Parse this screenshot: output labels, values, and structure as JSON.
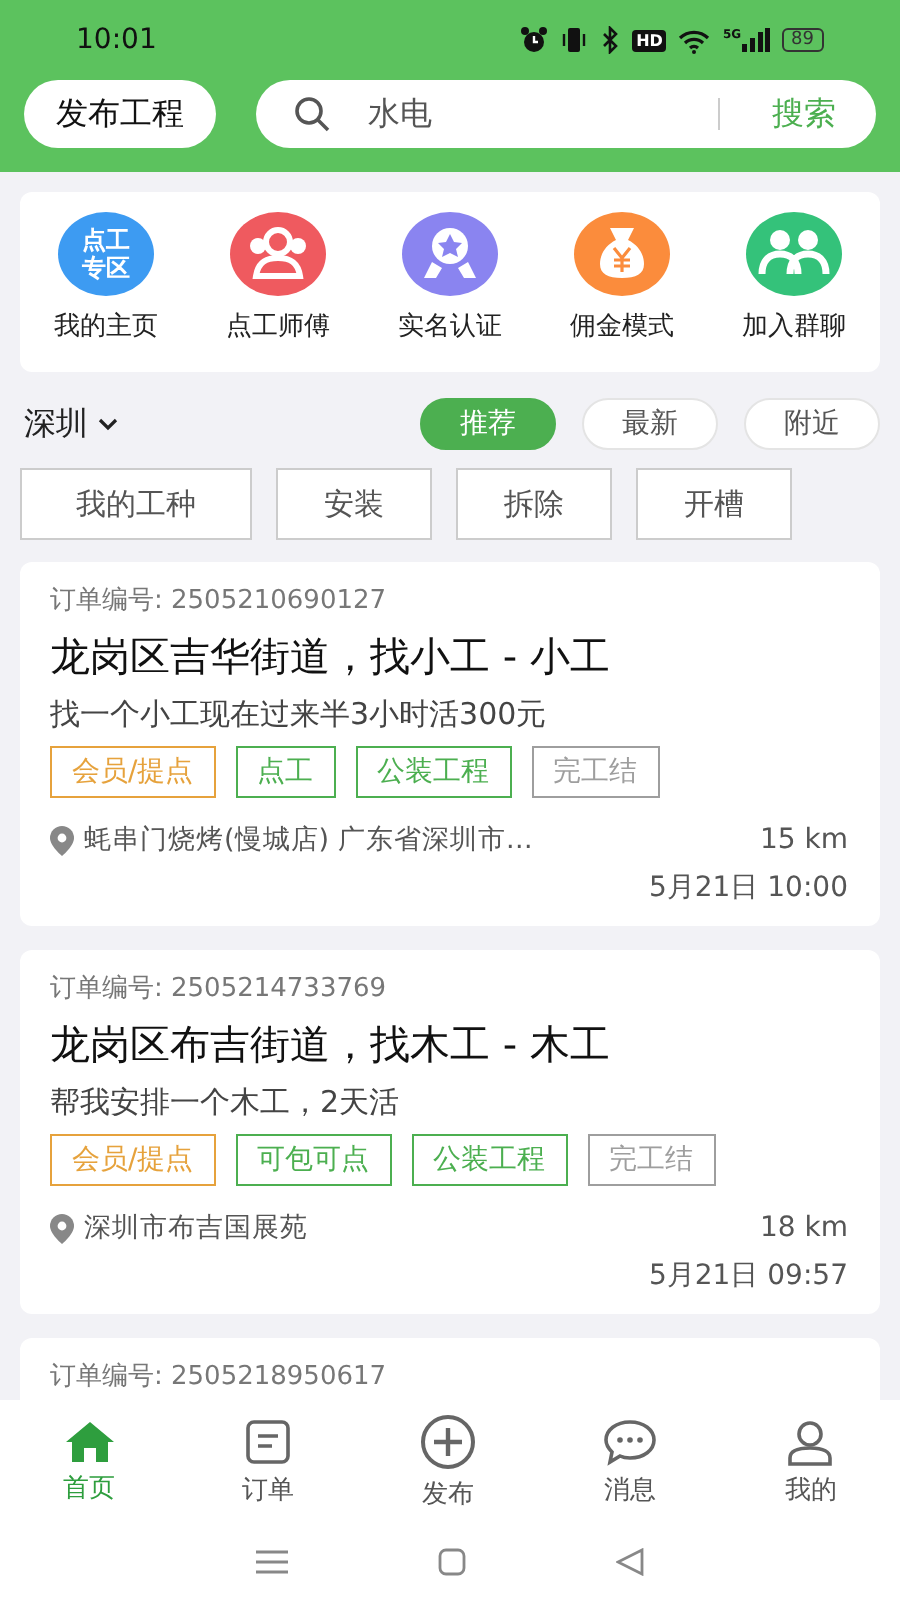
{
  "status_bar": {
    "time": "10:01",
    "hd": "HD",
    "network": "5G",
    "battery": "89"
  },
  "header": {
    "publish_button": "发布工程",
    "search": {
      "value": "水电",
      "button": "搜索"
    }
  },
  "shortcuts": [
    {
      "label": "我的主页",
      "kind": "text",
      "icon_text": "点工专区",
      "color": "#3d9bf2"
    },
    {
      "label": "点工师傅",
      "kind": "people",
      "color": "#ef5a5f"
    },
    {
      "label": "实名认证",
      "kind": "badge",
      "color": "#8a84f0"
    },
    {
      "label": "佣金模式",
      "kind": "moneybag",
      "color": "#fb8c3c"
    },
    {
      "label": "加入群聊",
      "kind": "group",
      "color": "#34c27a"
    }
  ],
  "city": "深圳",
  "sort_tabs": [
    {
      "label": "推荐",
      "selected": true
    },
    {
      "label": "最新",
      "selected": false
    },
    {
      "label": "附近",
      "selected": false
    }
  ],
  "categories": [
    "我的工种",
    "安装",
    "拆除",
    "开槽"
  ],
  "orders": [
    {
      "order_no": "订单编号: 2505210690127",
      "title": "龙岗区吉华街道，找小工 - 小工",
      "desc": "找一个小工现在过来半3小时活300元",
      "tags": [
        {
          "label": "会员/提点",
          "color": "#e6a23c"
        },
        {
          "label": "点工",
          "color": "#4caf50"
        },
        {
          "label": "公装工程",
          "color": "#4caf50"
        },
        {
          "label": "完工结",
          "color": "#9e9e9e"
        }
      ],
      "address": "蚝串门烧烤(慢城店) 广东省深圳市…",
      "distance": "15 km",
      "time": "5月21日  10:00"
    },
    {
      "order_no": "订单编号: 2505214733769",
      "title": "龙岗区布吉街道，找木工 - 木工",
      "desc": "帮我安排一个木工，2天活",
      "tags": [
        {
          "label": "会员/提点",
          "color": "#e6a23c"
        },
        {
          "label": "可包可点",
          "color": "#4caf50"
        },
        {
          "label": "公装工程",
          "color": "#4caf50"
        },
        {
          "label": "完工结",
          "color": "#9e9e9e"
        }
      ],
      "address": "深圳市布吉国展苑",
      "distance": "18 km",
      "time": "5月21日  09:57"
    },
    {
      "order_no": "订单编号: 2505218950617"
    }
  ],
  "tab_bar": [
    {
      "label": "首页",
      "kind": "home",
      "selected": true
    },
    {
      "label": "订单",
      "kind": "orders",
      "selected": false
    },
    {
      "label": "发布",
      "kind": "publish",
      "selected": false
    },
    {
      "label": "消息",
      "kind": "messages",
      "selected": false
    },
    {
      "label": "我的",
      "kind": "profile",
      "selected": false
    }
  ]
}
